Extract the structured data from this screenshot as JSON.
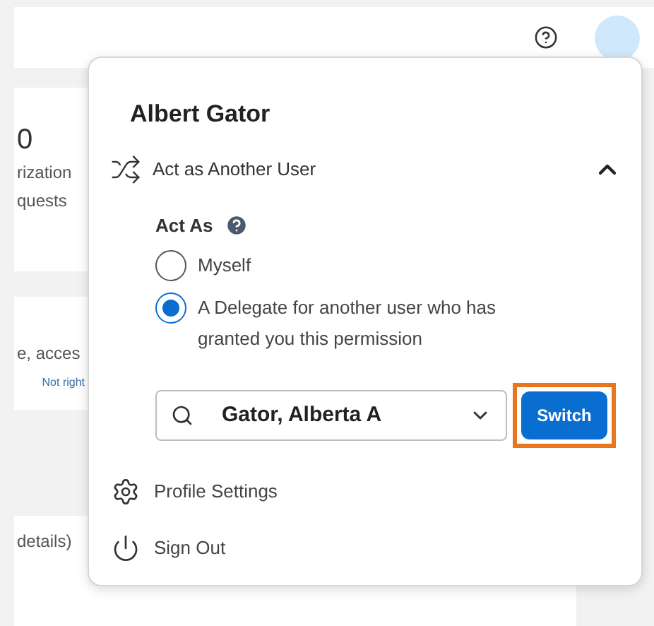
{
  "background": {
    "cards": [
      {
        "texts": [
          {
            "kind": "big",
            "text": "0"
          },
          {
            "kind": "body",
            "text": "rization"
          },
          {
            "kind": "body",
            "text": "quests"
          }
        ]
      },
      {
        "texts": [
          {
            "kind": "body",
            "text": "e, acces"
          },
          {
            "kind": "link",
            "text": "Not right"
          }
        ]
      },
      {
        "texts": [
          {
            "kind": "body",
            "text": "details)"
          }
        ]
      }
    ]
  },
  "popup": {
    "user_name": "Albert Gator",
    "section": {
      "label": "Act as Another User",
      "expanded": true
    },
    "act_as": {
      "label": "Act As",
      "options": [
        {
          "label": "Myself",
          "selected": false
        },
        {
          "label": "A Delegate for another user who has granted you this permission",
          "selected": true
        }
      ]
    },
    "delegate_field": {
      "value": "Gator, Alberta A"
    },
    "switch_button": {
      "label": "Switch",
      "highlighted": true
    },
    "menu": [
      {
        "kind": "settings",
        "label": "Profile Settings"
      },
      {
        "kind": "signout",
        "label": "Sign Out"
      }
    ]
  }
}
